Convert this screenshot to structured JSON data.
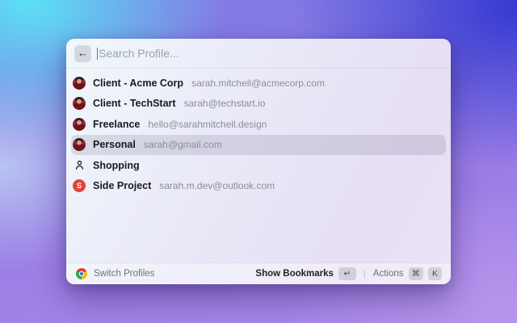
{
  "search": {
    "placeholder": "Search Profile..."
  },
  "profiles": [
    {
      "name": "Client - Acme Corp",
      "email": "sarah.mitchell@acmecorp.com",
      "icon": "avatar-photo",
      "selected": false
    },
    {
      "name": "Client - TechStart",
      "email": "sarah@techstart.io",
      "icon": "avatar-photo",
      "selected": false
    },
    {
      "name": "Freelance",
      "email": "hello@sarahmitchell.design",
      "icon": "avatar-photo",
      "selected": false
    },
    {
      "name": "Personal",
      "email": "sarah@gmail.com",
      "icon": "avatar-photo",
      "selected": true
    },
    {
      "name": "Shopping",
      "email": "",
      "icon": "person-outline",
      "selected": false
    },
    {
      "name": "Side Project",
      "email": "sarah.m.dev@outlook.com",
      "icon": "letter-badge",
      "badge_letter": "S",
      "badge_color": "#e2453a",
      "selected": false
    }
  ],
  "toolbar": {
    "back_icon": "←"
  },
  "footer": {
    "left_label": "Switch Profiles",
    "bookmarks_label": "Show Bookmarks",
    "bookmarks_key": "↵",
    "divider": "|",
    "actions_label": "Actions",
    "actions_keys": [
      "⌘",
      "K"
    ]
  },
  "colors": {
    "badge_red": "#e2453a",
    "selection": "rgba(96,90,122,0.17)",
    "bg_cyan": "#5ce2f5",
    "bg_indigo": "#3539d1",
    "bg_purple": "#9a7ce5"
  }
}
